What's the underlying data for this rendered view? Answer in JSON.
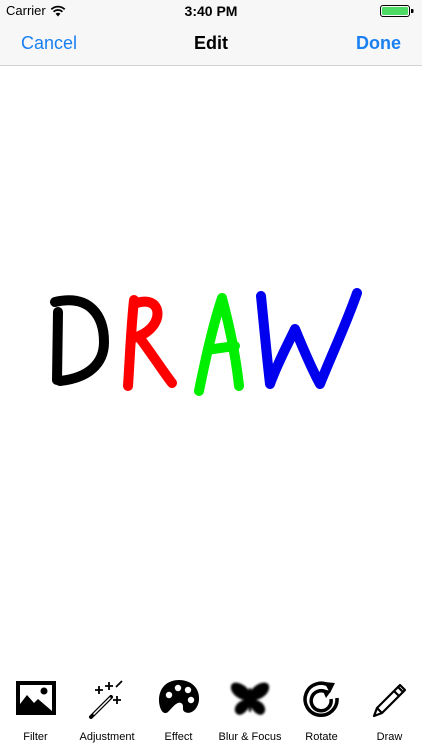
{
  "status_bar": {
    "carrier": "Carrier",
    "time": "3:40 PM",
    "battery_color": "#4cd964"
  },
  "nav": {
    "cancel_label": "Cancel",
    "title": "Edit",
    "done_label": "Done",
    "accent_color": "#1a80f0"
  },
  "canvas": {
    "drawing_text": "DRAW",
    "letter_colors": [
      "#000000",
      "#ff0000",
      "#00ee00",
      "#0000ee"
    ]
  },
  "toolbar": {
    "tools": [
      {
        "label": "Filter",
        "icon": "landscape-photo-icon"
      },
      {
        "label": "Adjustment",
        "icon": "magic-wand-icon"
      },
      {
        "label": "Effect",
        "icon": "palette-icon"
      },
      {
        "label": "Blur & Focus",
        "icon": "butterfly-icon"
      },
      {
        "label": "Rotate",
        "icon": "rotate-icon"
      },
      {
        "label": "Draw",
        "icon": "pencil-icon"
      }
    ]
  }
}
